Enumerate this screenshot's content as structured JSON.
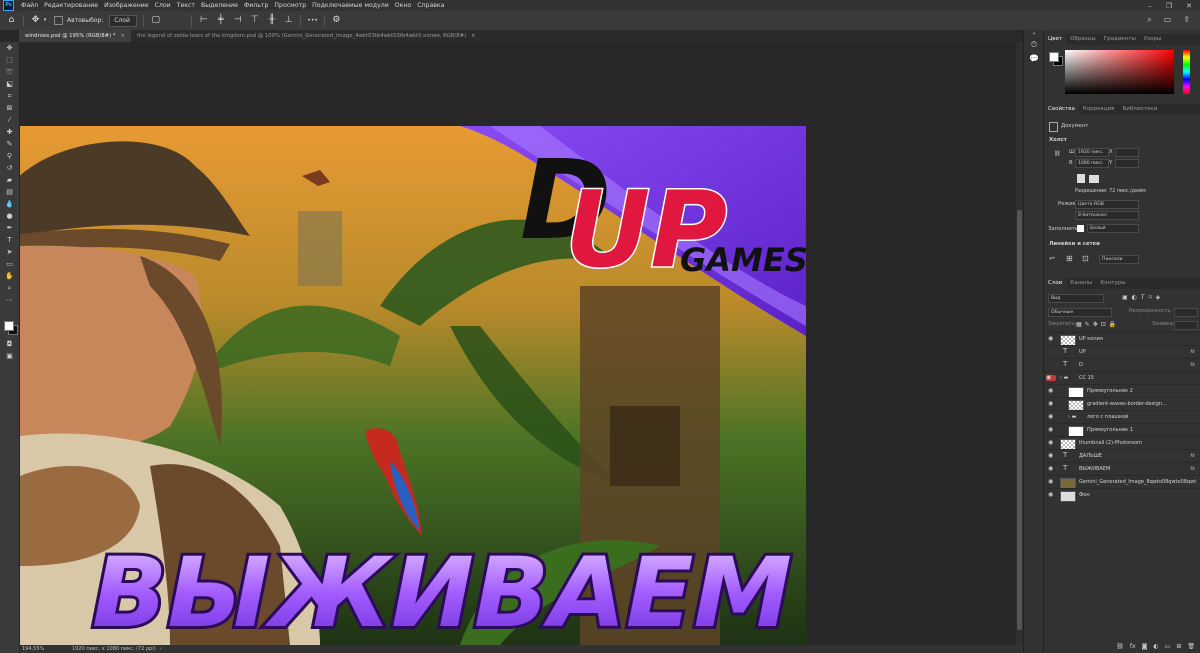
{
  "app": {
    "logo_text": "Ps"
  },
  "menu": [
    "Файл",
    "Редактирование",
    "Изображение",
    "Слои",
    "Текст",
    "Выделение",
    "Фильтр",
    "Просмотр",
    "Подключаемые модули",
    "Окно",
    "Справка"
  ],
  "window_controls": {
    "minimize": "–",
    "restore": "❐",
    "close": "✕"
  },
  "options_bar": {
    "autoselect_label": "Автовыбор:",
    "autoselect_value": "Слой",
    "more": "•••"
  },
  "tabs": [
    {
      "label": "windroee.psd @ 195% (RGB/8#) *",
      "active": true
    },
    {
      "label": "the legend of zelda tears of the kingdom.psd @ 100% (Gemini_Generated_Image_4wkt03tb4wkt03tb4wkt0 копия, RGB/8#)",
      "active": false
    }
  ],
  "canvas_artwork": {
    "logo_letters": "UP",
    "logo_d": "D",
    "logo_games": "GAMES",
    "headline": "ВЫЖИВАЕМ"
  },
  "status": {
    "zoom": "194.55%",
    "info": "1920 пикс. x 1080 пикс. (72 ppi)"
  },
  "color_panel": {
    "tabs": [
      "Цвет",
      "Образцы",
      "Градиенты",
      "Узоры"
    ],
    "fg": "#ffffff",
    "bg": "#000000"
  },
  "properties_panel": {
    "tabs": [
      "Свойства",
      "Коррекция",
      "Библиотеки"
    ],
    "doc_label": "Документ",
    "canvas_section": "Холст",
    "w_label": "Ш",
    "w": "1920 пикс.",
    "x_label": "X",
    "h_label": "В",
    "h": "1080 пикс.",
    "y_label": "Y",
    "resolution": "Разрешение: 72 пикс./дюйм",
    "mode_label": "Режим",
    "mode": "Цвета RGB",
    "bits": "8 бит/канал",
    "fill_label": "Заполнить",
    "fill": "Белый",
    "rulers_section": "Линейки и сетки",
    "units": "Пиксели"
  },
  "layers_panel": {
    "tabs": [
      "Слои",
      "Каналы",
      "Контуры"
    ],
    "filter": "Вид",
    "blend_mode": "Обычные",
    "opacity_label": "Непрозрачность:",
    "lock_label": "Закрепить:",
    "fill_label": "Заливка:",
    "layers": [
      {
        "name": "UP копия",
        "type": "raster",
        "indent": 0,
        "fx": false,
        "visible": true
      },
      {
        "name": "UP",
        "type": "text",
        "indent": 0,
        "fx": true,
        "visible": false
      },
      {
        "name": "D",
        "type": "text",
        "indent": 0,
        "fx": true,
        "visible": false
      },
      {
        "name": "CC 15",
        "type": "group",
        "indent": 0,
        "fx": false,
        "visible": true,
        "eye_color": "#c83a3a"
      },
      {
        "name": "Прямоугольник 2",
        "type": "shape",
        "indent": 1,
        "fx": false,
        "visible": true
      },
      {
        "name": "gradient-waves-border-design…",
        "type": "raster",
        "indent": 1,
        "fx": false,
        "visible": true
      },
      {
        "name": "лого с плашкой",
        "type": "group",
        "indent": 1,
        "fx": false,
        "visible": true
      },
      {
        "name": "Прямоугольник 1",
        "type": "shape",
        "indent": 1,
        "fx": false,
        "visible": true
      },
      {
        "name": "thumbnail (2)-Photoroom",
        "type": "raster",
        "indent": 0,
        "fx": false,
        "visible": true
      },
      {
        "name": "ДАЛЬШЕ",
        "type": "text",
        "indent": 0,
        "fx": true,
        "visible": true
      },
      {
        "name": "ВЫЖИВАЕМ",
        "type": "text",
        "indent": 0,
        "fx": true,
        "visible": true
      },
      {
        "name": "Gemini_Generated_Image_8qwto08qwto08qwt",
        "type": "image",
        "indent": 0,
        "fx": false,
        "visible": true
      },
      {
        "name": "Фон",
        "type": "background",
        "indent": 0,
        "fx": false,
        "visible": true
      }
    ]
  },
  "colors": {
    "accent_purple": "#7b3cf0",
    "logo_red": "#e0173f"
  }
}
